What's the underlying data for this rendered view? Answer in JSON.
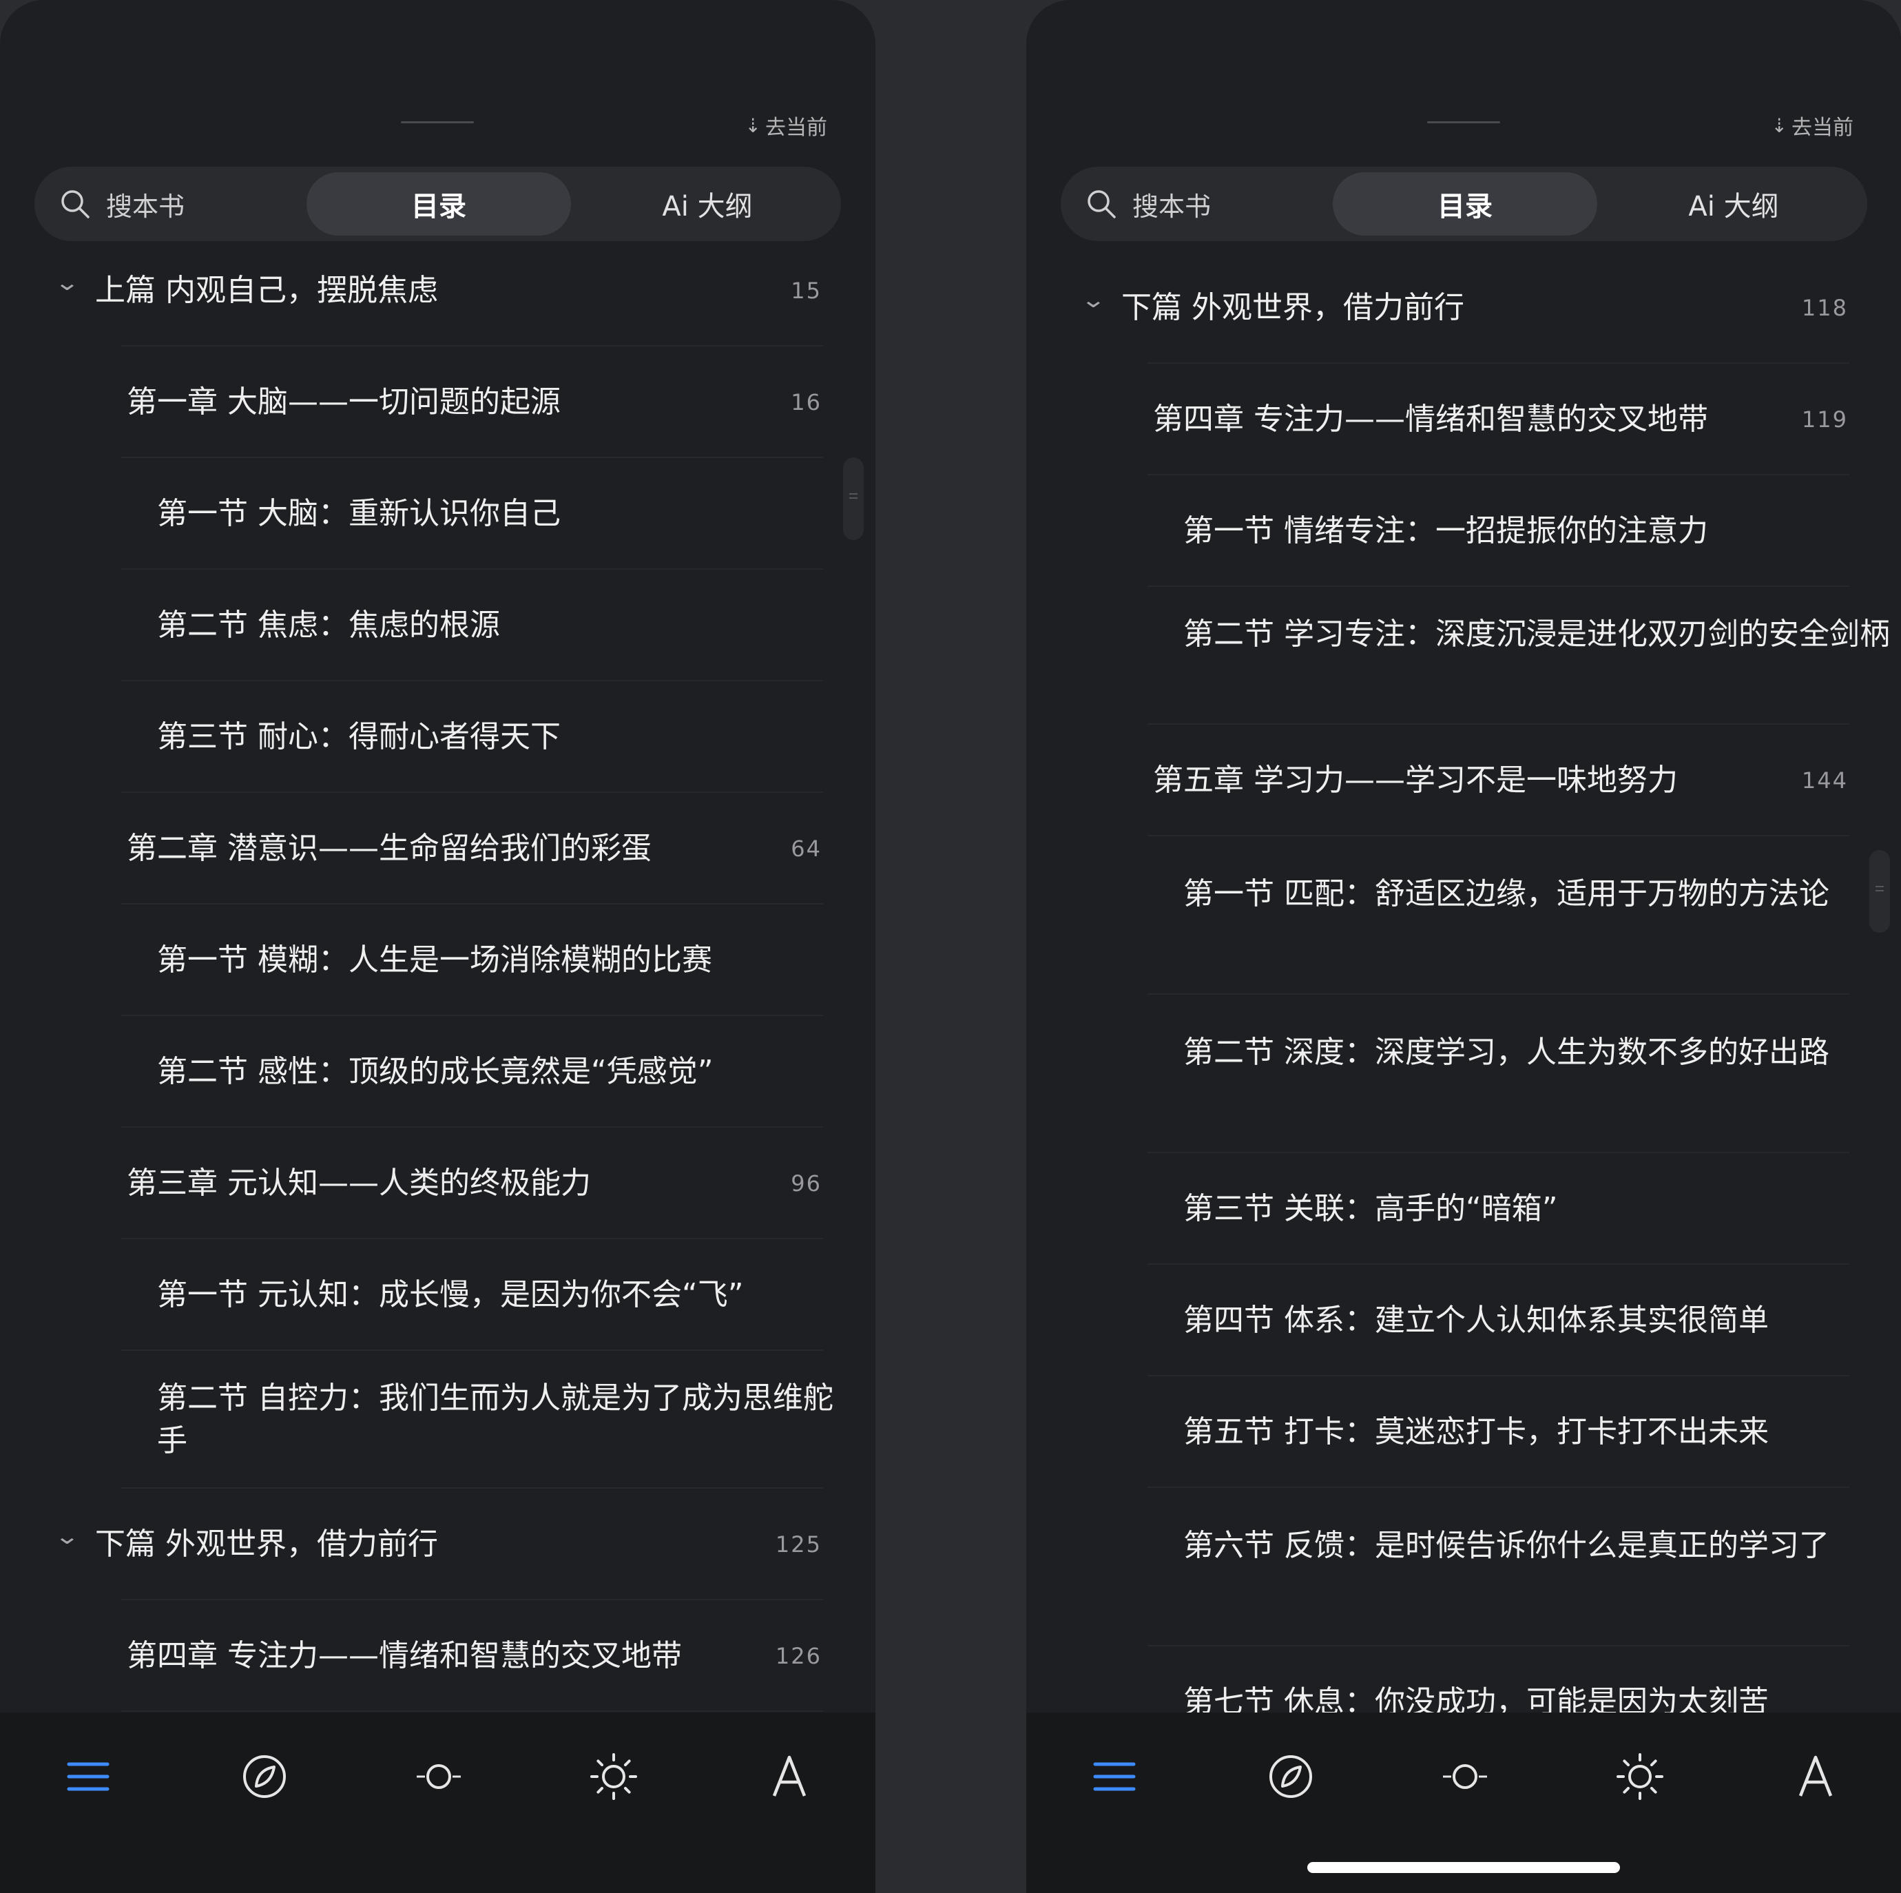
{
  "colors": {
    "accent": "#3d8bfd",
    "background": "#1e1f22",
    "text": "#efefef",
    "page_number": "#9a9a9e"
  },
  "panels": [
    {
      "goto_current": "去当前",
      "tabs": {
        "search": "搜本书",
        "toc": "目录",
        "ai": "Ai 大纲",
        "active": "toc"
      },
      "toc": [
        {
          "level": 0,
          "title": "上篇 内观自己，摆脱焦虑",
          "page": "15"
        },
        {
          "level": 1,
          "title": "第一章 大脑——一切问题的起源",
          "page": "16"
        },
        {
          "level": 2,
          "title": "第一节 大脑：重新认识你自己",
          "page": ""
        },
        {
          "level": 2,
          "title": "第二节 焦虑：焦虑的根源",
          "page": ""
        },
        {
          "level": 2,
          "title": "第三节 耐心：得耐心者得天下",
          "page": ""
        },
        {
          "level": 1,
          "title": "第二章 潜意识——生命留给我们的彩蛋",
          "page": "64"
        },
        {
          "level": 2,
          "title": "第一节 模糊：人生是一场消除模糊的比赛",
          "page": ""
        },
        {
          "level": 2,
          "title": "第二节 感性：顶级的成长竟然是“凭感觉”",
          "page": ""
        },
        {
          "level": 1,
          "title": "第三章 元认知——人类的终极能力",
          "page": "96"
        },
        {
          "level": 2,
          "title": "第一节 元认知：成长慢，是因为你不会“飞”",
          "page": ""
        },
        {
          "level": 2,
          "title": "第二节 自控力：我们生而为人就是为了成为思维舵手",
          "page": ""
        },
        {
          "level": 0,
          "title": "下篇 外观世界，借力前行",
          "page": "125"
        },
        {
          "level": 1,
          "title": "第四章 专注力——情绪和智慧的交叉地带",
          "page": "126"
        }
      ]
    },
    {
      "goto_current": "去当前",
      "tabs": {
        "search": "搜本书",
        "toc": "目录",
        "ai": "Ai 大纲",
        "active": "toc"
      },
      "toc": [
        {
          "level": 0,
          "title": "下篇 外观世界，借力前行",
          "page": "118"
        },
        {
          "level": 1,
          "title": "第四章 专注力——情绪和智慧的交叉地带",
          "page": "119"
        },
        {
          "level": 2,
          "title": "第一节 情绪专注：一招提振你的注意力",
          "page": ""
        },
        {
          "level": 2,
          "title": "第二节 学习专注：深度沉浸是进化双刃剑的安全剑柄",
          "page": ""
        },
        {
          "level": 1,
          "title": "第五章 学习力——学习不是一味地努力",
          "page": "144"
        },
        {
          "level": 2,
          "title": "第一节 匹配：舒适区边缘，适用于万物的方法论",
          "page": ""
        },
        {
          "level": 2,
          "title": "第二节 深度：深度学习，人生为数不多的好出路",
          "page": ""
        },
        {
          "level": 2,
          "title": "第三节 关联：高手的“暗箱”",
          "page": ""
        },
        {
          "level": 2,
          "title": "第四节 体系：建立个人认知体系其实很简单",
          "page": ""
        },
        {
          "level": 2,
          "title": "第五节 打卡：莫迷恋打卡，打卡打不出未来",
          "page": ""
        },
        {
          "level": 2,
          "title": "第六节 反馈：是时候告诉你什么是真正的学习了",
          "page": ""
        },
        {
          "level": 2,
          "title": "第七节 休息：你没成功，可能是因为太刻苦",
          "page": ""
        }
      ]
    }
  ],
  "toolbar": [
    {
      "name": "toc-menu-icon",
      "active": true
    },
    {
      "name": "compass-icon",
      "active": false
    },
    {
      "name": "progress-icon",
      "active": false
    },
    {
      "name": "brightness-icon",
      "active": false
    },
    {
      "name": "font-icon",
      "label": "A",
      "active": false
    }
  ]
}
